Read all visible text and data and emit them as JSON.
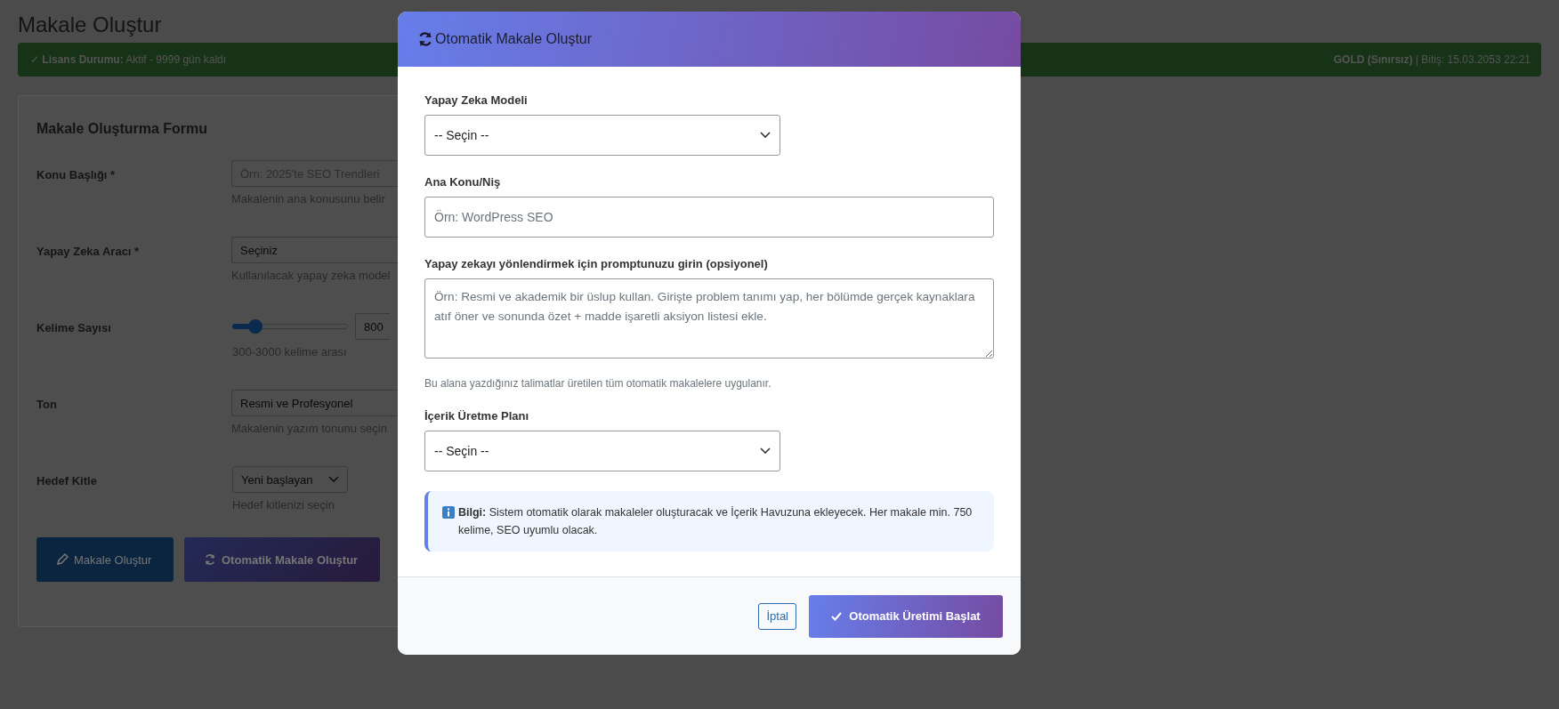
{
  "page": {
    "title": "Makale Oluştur"
  },
  "license": {
    "status": "✓ **Lisans Durumu:** Aktif - 9999 gün kaldı",
    "plan": "**GOLD (Sınırsız)** | Bitiş: 15.03.2053 22:21"
  },
  "form": {
    "title": "Makale Oluşturma Formu",
    "fields": [
      {
        "kind": "text",
        "label": "Konu Başlığı *",
        "placeholder": "Örn: 2025'te SEO Trendleri",
        "help": "Makalenin ana konusunu belir"
      },
      {
        "kind": "select",
        "label": "Yapay Zeka Aracı *",
        "value": "Seçiniz",
        "help": "Kullanılacak yapay zeka model"
      },
      {
        "kind": "range",
        "label": "Kelime Sayısı",
        "level": 0.2,
        "value": "800",
        "help": "300-3000 kelime arası"
      },
      {
        "kind": "select",
        "label": "Ton",
        "value": "Resmi ve Profesyonel",
        "help": "Makalenin yazım tonunu seçin"
      },
      {
        "kind": "dropdown",
        "label": "Hedef Kitle",
        "value": "Yeni başlayan",
        "help": "Hedef kitlenizi seçin"
      }
    ],
    "buttons": [
      {
        "kind": "pencil",
        "label": "Makale Oluştur"
      },
      {
        "kind": "refresh",
        "label": "Otomatik Makale Oluştur"
      }
    ]
  },
  "modal": {
    "title": "Otomatik Makale Oluştur",
    "fields": [
      {
        "kind": "select",
        "label": "Yapay Zeka Modeli",
        "value": "-- Seçin --"
      },
      {
        "kind": "text",
        "label": "Ana Konu/Niş",
        "placeholder": "Örn: WordPress SEO"
      },
      {
        "kind": "textarea",
        "label": "Yapay zekayı yönlendirmek için promptunuzu girin (opsiyonel)",
        "placeholder": "Örn: Resmi ve akademik bir üslup kullan. Girişte problem tanımı yap, her bölümde gerçek kaynaklara atıf öner ve sonunda özet + madde işaretli aksiyon listesi ekle.",
        "help": "Bu alana yazdığınız talimatlar üretilen tüm otomatik makalelere uygulanır."
      },
      {
        "kind": "select",
        "label": "İçerik Üretme Planı",
        "value": "-- Seçin --"
      }
    ],
    "info": "**Bilgi:** Sistem otomatik olarak makaleler oluşturacak ve İçerik Havuzuna ekleyecek. Her makale min. 750 kelime, SEO uyumlu olacak.",
    "cancel": "İptal",
    "submit": "Otomatik Üretimi Başlat"
  }
}
